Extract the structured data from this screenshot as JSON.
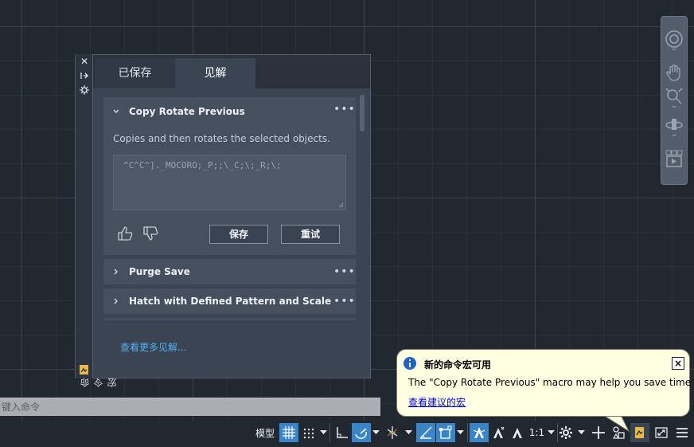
{
  "palette": {
    "side_title": "命令宏",
    "tabs": [
      "已保存",
      "见解"
    ],
    "active_tab": "见解",
    "expanded_card": {
      "title": "Copy Rotate Previous",
      "description": "Copies and then rotates the selected objects.",
      "macro": "^C^C^]._MOCORO;_P;;\\_C;\\;_R;\\;",
      "save_label": "保存",
      "retry_label": "重试"
    },
    "collapsed_cards": [
      {
        "title": "Purge Save"
      },
      {
        "title": "Hatch with Defined Pattern and Scale"
      }
    ],
    "more_menu_glyph": "•••",
    "more_insights_link": "查看更多见解..."
  },
  "command_line": {
    "placeholder": "键入命令"
  },
  "notification": {
    "title": "新的命令宏可用",
    "message": "The \"Copy Rotate Previous\" macro may help you save time",
    "link": "查看建议的宏",
    "close_glyph": "×"
  },
  "status_bar": {
    "model_label": "模型",
    "scale_label": "1:1",
    "accent_color": "#3a85c8"
  },
  "navbar": {
    "icons": [
      "steering-wheel-icon",
      "pan-icon",
      "zoom-icon",
      "orbit-icon",
      "showmotion-icon"
    ]
  }
}
